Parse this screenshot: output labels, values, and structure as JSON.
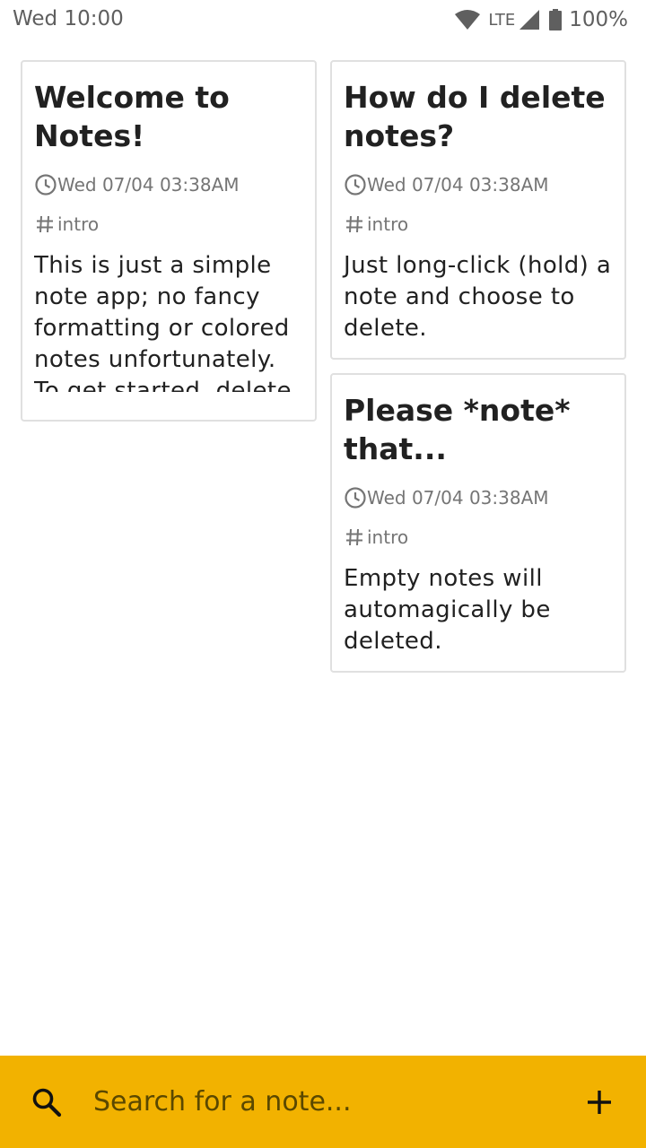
{
  "status_bar": {
    "time": "Wed 10:00",
    "network": "LTE",
    "battery": "100%"
  },
  "notes": [
    {
      "title": "Welcome to Notes!",
      "date": "Wed 07/04 03:38AM",
      "tag": "intro",
      "body": "This is just a simple note app; no fancy formatting or colored notes unfortunately. To get started, delete"
    },
    {
      "title": "How do I delete notes?",
      "date": "Wed 07/04 03:38AM",
      "tag": "intro",
      "body": "Just long-click (hold) a note and choose to delete."
    },
    {
      "title": "Please *note* that...",
      "date": "Wed 07/04 03:38AM",
      "tag": "intro",
      "body": "Empty notes will automagically be deleted."
    }
  ],
  "search": {
    "placeholder": "Search for a note..."
  },
  "icons": {
    "search": "search-icon",
    "add": "plus-icon",
    "date": "clock-icon",
    "tag": "hash-icon",
    "wifi": "wifi-icon",
    "signal": "signal-icon",
    "battery": "battery-icon"
  },
  "colors": {
    "accent": "#f2b200",
    "card_border": "#e0e0e0",
    "meta_text": "#757575"
  }
}
